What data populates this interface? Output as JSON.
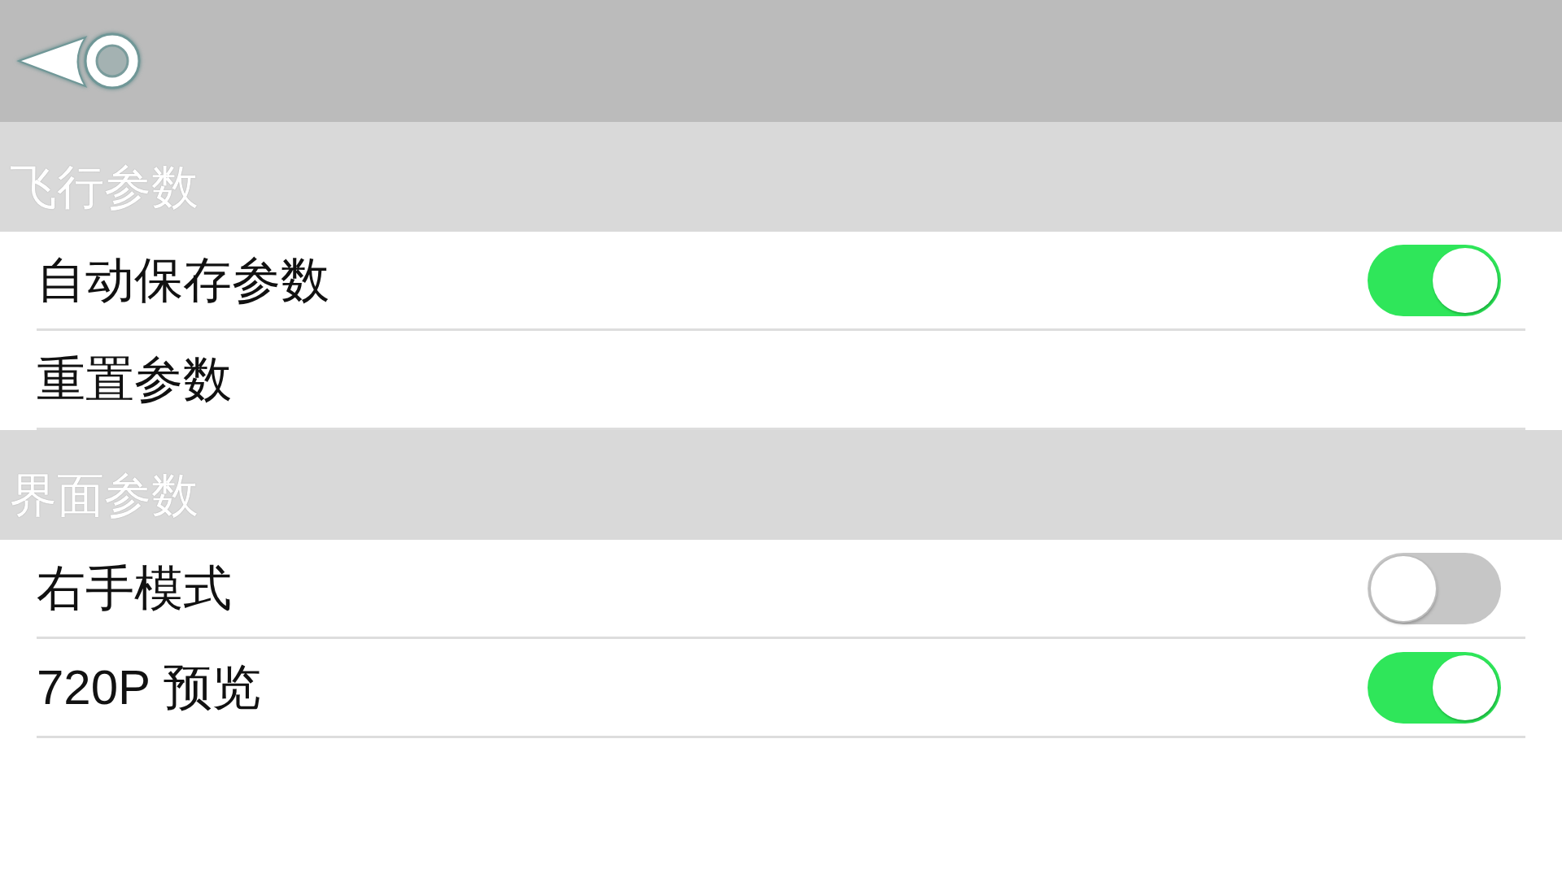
{
  "sections": [
    {
      "title": "飞行参数",
      "rows": [
        {
          "kind": "switch",
          "label": "自动保存参数",
          "on": true
        },
        {
          "kind": "action",
          "label": "重置参数"
        }
      ]
    },
    {
      "title": "界面参数",
      "rows": [
        {
          "kind": "switch",
          "label": "右手模式",
          "on": false
        },
        {
          "kind": "switch",
          "label": "720P 预览",
          "on": true
        }
      ]
    }
  ]
}
